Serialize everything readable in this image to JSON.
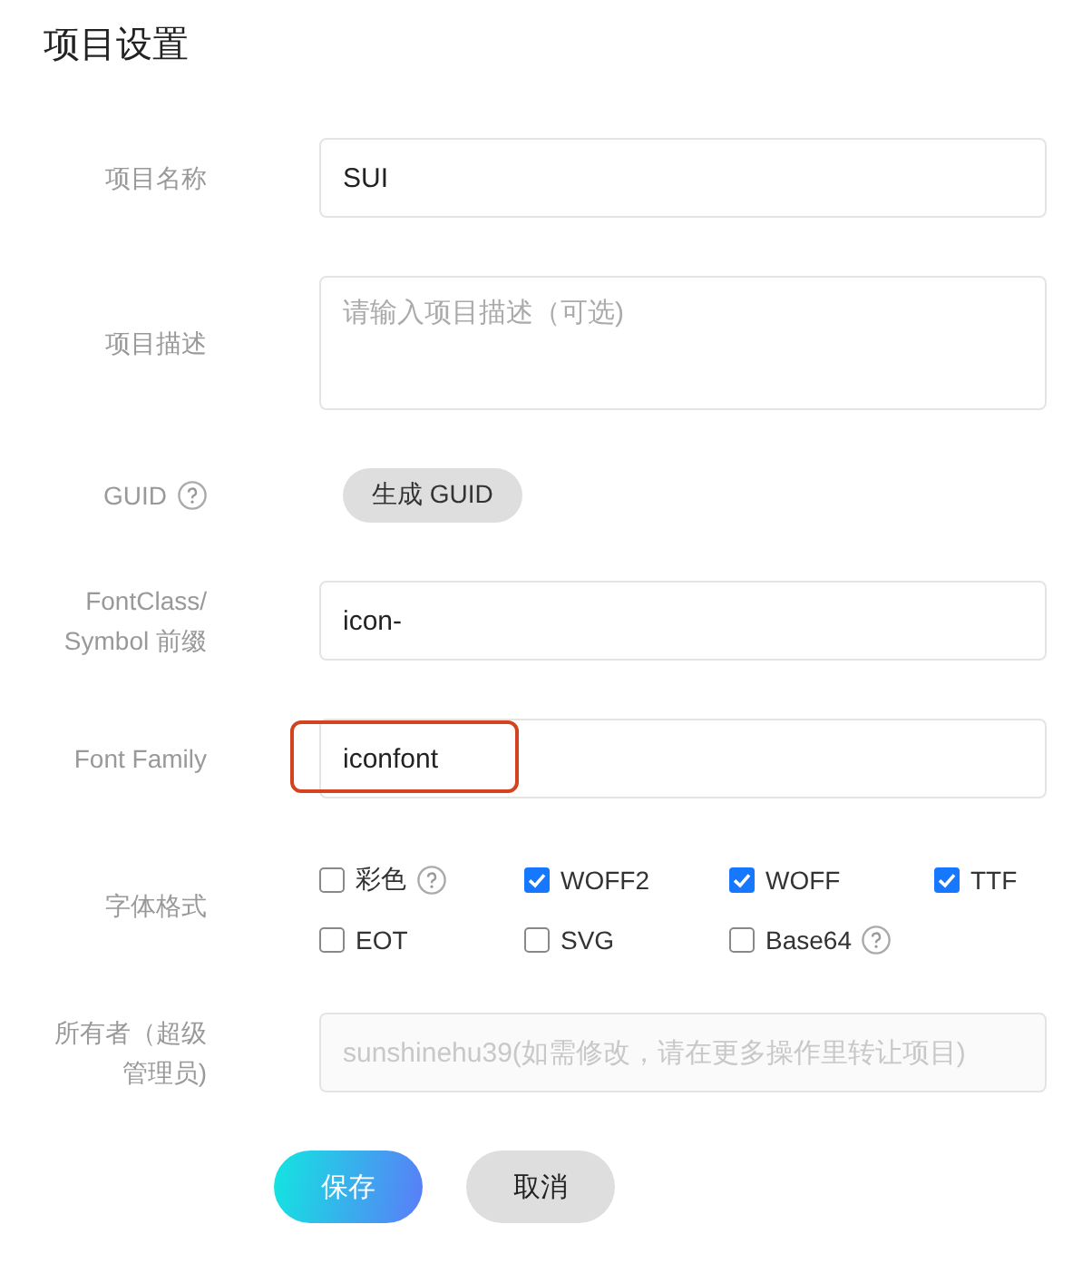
{
  "title": "项目设置",
  "fields": [
    {
      "kind": "input",
      "label": "项目名称",
      "value": "SUI"
    },
    {
      "kind": "textarea",
      "label": "项目描述",
      "placeholder": "请输入项目描述（可选)"
    },
    {
      "kind": "button",
      "label": "GUID",
      "help": true,
      "button": "生成 GUID"
    },
    {
      "kind": "input",
      "label": "FontClass/ Symbol 前缀",
      "value": "icon-"
    },
    {
      "kind": "input",
      "label": "Font Family",
      "value": "iconfont",
      "highlighted": true
    },
    {
      "kind": "checkboxes",
      "label": "字体格式",
      "options": [
        {
          "label": "彩色",
          "checked": false,
          "help": true
        },
        {
          "label": "WOFF2",
          "checked": true,
          "help": false
        },
        {
          "label": "WOFF",
          "checked": true,
          "help": false
        },
        {
          "label": "TTF",
          "checked": true,
          "help": false
        },
        {
          "label": "EOT",
          "checked": false,
          "help": false
        },
        {
          "label": "SVG",
          "checked": false,
          "help": false
        },
        {
          "label": "Base64",
          "checked": false,
          "help": true
        }
      ]
    },
    {
      "kind": "input",
      "label": "所有者（超级管理员)",
      "value": "sunshinehu39(如需修改，请在更多操作里转让项目)",
      "disabled": true
    }
  ],
  "actions": [
    {
      "label": "保存",
      "kind": "primary"
    },
    {
      "label": "取消",
      "kind": "secondary"
    }
  ]
}
